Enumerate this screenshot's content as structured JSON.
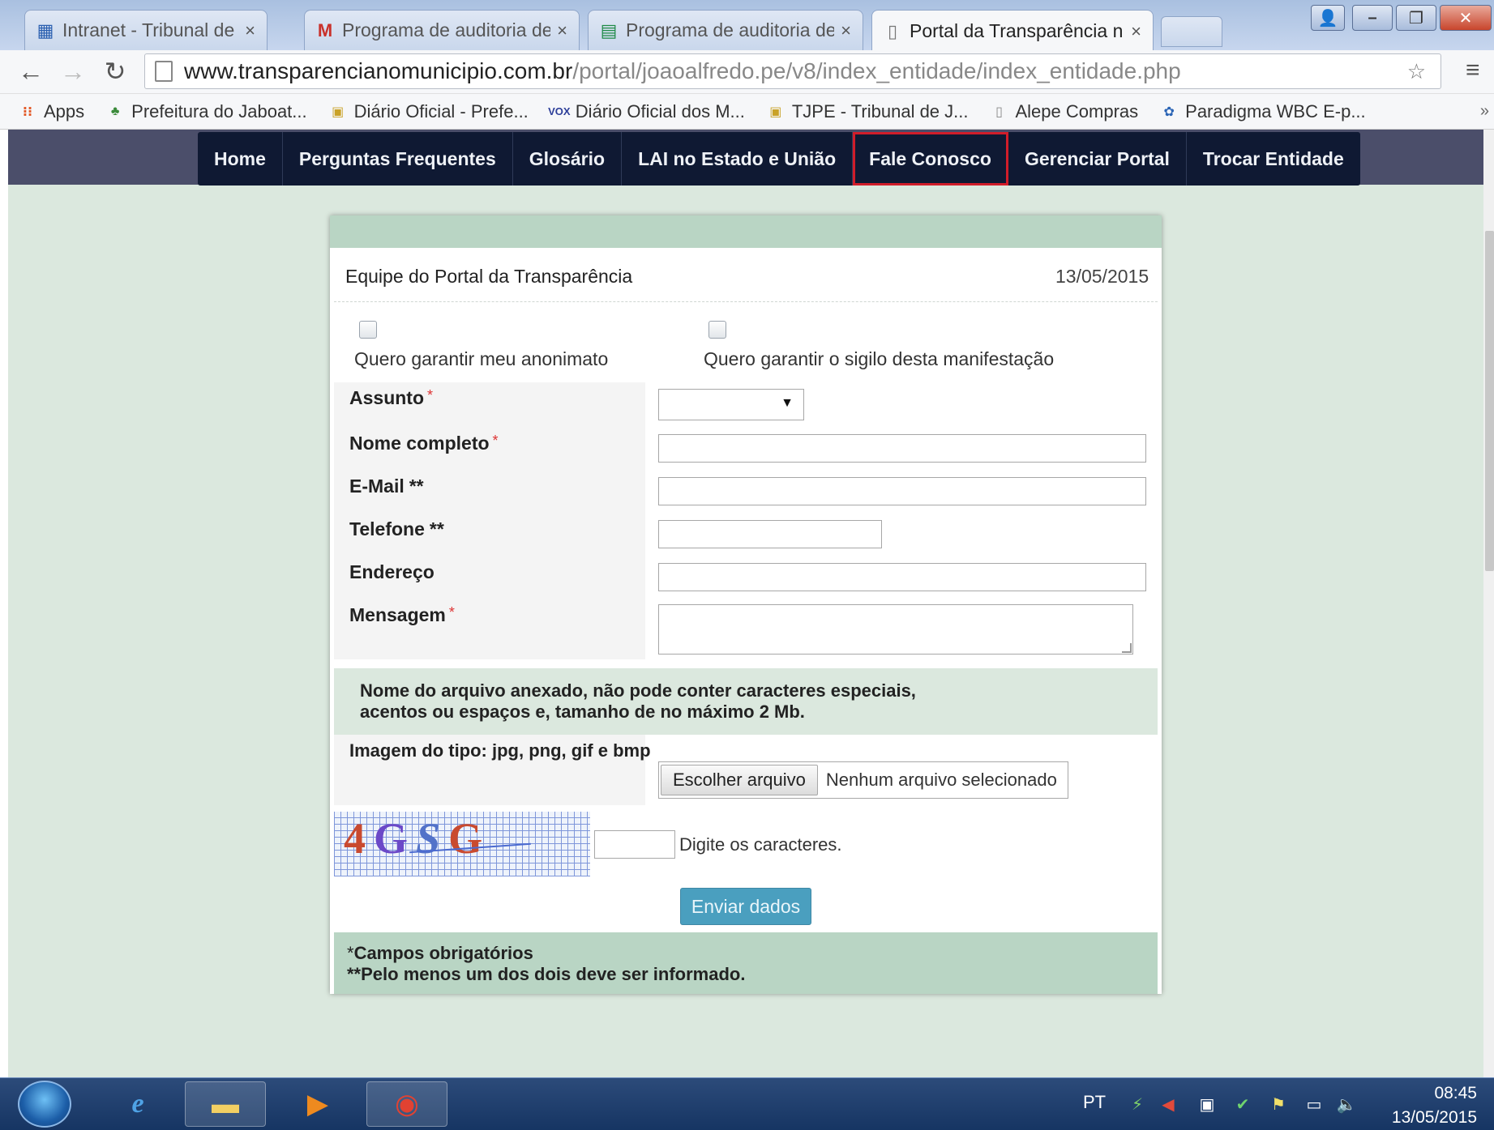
{
  "browser": {
    "tabs": [
      {
        "title": "Intranet - Tribunal de Con",
        "icon": "intranet-icon"
      },
      {
        "title": "Programa de auditoria de",
        "icon": "gmail-icon"
      },
      {
        "title": "Programa de auditoria de",
        "icon": "sheets-icon"
      },
      {
        "title": "Portal da Transparência n",
        "icon": "page-icon",
        "active": true
      }
    ],
    "tab_close_glyph": "×",
    "url_host": "www.transparencianomunicipio.com.br",
    "url_path": "/portal/joaoalfredo.pe/v8/index_entidade/index_entidade.php",
    "bookmarks": [
      {
        "label": "Apps",
        "icon": "apps-icon"
      },
      {
        "label": "Prefeitura do Jaboat...",
        "icon": "prefeitura-icon"
      },
      {
        "label": "Diário Oficial - Prefe...",
        "icon": "diario-icon"
      },
      {
        "label": "Diário Oficial dos M...",
        "icon": "vox-icon"
      },
      {
        "label": "TJPE - Tribunal de J...",
        "icon": "tjpe-icon"
      },
      {
        "label": "Alepe Compras",
        "icon": "page-icon"
      },
      {
        "label": "Paradigma WBC E-p...",
        "icon": "paradigma-icon"
      }
    ],
    "bookmarks_more": "»"
  },
  "nav": {
    "items": [
      {
        "label": "Home"
      },
      {
        "label": "Perguntas Frequentes"
      },
      {
        "label": "Glosário"
      },
      {
        "label": "LAI no Estado e União"
      },
      {
        "label": "Fale Conosco",
        "highlighted": true
      },
      {
        "label": "Gerenciar Portal"
      },
      {
        "label": "Trocar Entidade"
      }
    ]
  },
  "form": {
    "team": "Equipe do Portal da Transparência",
    "date": "13/05/2015",
    "anon_label": "Quero garantir meu anonimato",
    "secret_label": "Quero garantir o sigilo desta manifestação",
    "assunto_label": "Assunto",
    "nome_label": "Nome completo",
    "email_label": "E-Mail",
    "telefone_label": "Telefone",
    "endereco_label": "Endereço",
    "mensagem_label": "Mensagem",
    "required_mark": "*",
    "double_mark": "**",
    "notice_line1": "Nome do arquivo anexado, não pode conter caracteres especiais,",
    "notice_line2": "acentos ou espaços e, tamanho de no máximo 2 Mb.",
    "image_type_label": "Imagem do tipo: jpg, png, gif e bmp",
    "file_button": "Escolher arquivo",
    "file_status": "Nenhum arquivo selecionado",
    "captcha_chars": [
      "4",
      "G",
      "S",
      "G"
    ],
    "captcha_hint": "Digite os caracteres.",
    "submit_label": "Enviar dados",
    "footnote_star": "*",
    "footnote_1": "Campos obrigatórios",
    "footnote_2": "**Pelo menos um dos dois deve ser informado."
  },
  "taskbar": {
    "apps": [
      {
        "name": "ie-icon"
      },
      {
        "name": "explorer-icon"
      },
      {
        "name": "media-player-icon"
      },
      {
        "name": "chrome-icon"
      }
    ],
    "language": "PT",
    "time": "08:45",
    "date": "13/05/2015"
  },
  "colors": {
    "nav_bg": "#0f1933",
    "highlight_border": "#d11d2a",
    "page_bg": "#dbe8de",
    "card_band": "#b9d5c4",
    "submit_bg": "#4a9fbf"
  }
}
